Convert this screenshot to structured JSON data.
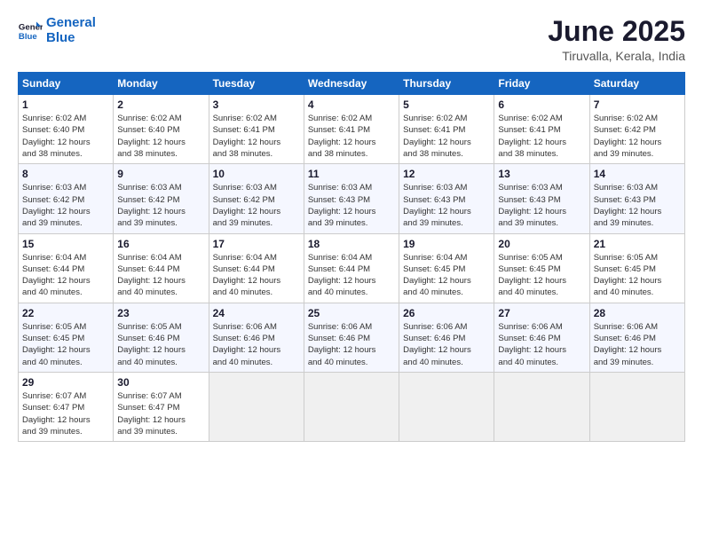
{
  "logo": {
    "line1": "General",
    "line2": "Blue"
  },
  "title": "June 2025",
  "subtitle": "Tiruvalla, Kerala, India",
  "weekdays": [
    "Sunday",
    "Monday",
    "Tuesday",
    "Wednesday",
    "Thursday",
    "Friday",
    "Saturday"
  ],
  "weeks": [
    [
      {
        "day": "1",
        "detail": "Sunrise: 6:02 AM\nSunset: 6:40 PM\nDaylight: 12 hours\nand 38 minutes."
      },
      {
        "day": "2",
        "detail": "Sunrise: 6:02 AM\nSunset: 6:40 PM\nDaylight: 12 hours\nand 38 minutes."
      },
      {
        "day": "3",
        "detail": "Sunrise: 6:02 AM\nSunset: 6:41 PM\nDaylight: 12 hours\nand 38 minutes."
      },
      {
        "day": "4",
        "detail": "Sunrise: 6:02 AM\nSunset: 6:41 PM\nDaylight: 12 hours\nand 38 minutes."
      },
      {
        "day": "5",
        "detail": "Sunrise: 6:02 AM\nSunset: 6:41 PM\nDaylight: 12 hours\nand 38 minutes."
      },
      {
        "day": "6",
        "detail": "Sunrise: 6:02 AM\nSunset: 6:41 PM\nDaylight: 12 hours\nand 38 minutes."
      },
      {
        "day": "7",
        "detail": "Sunrise: 6:02 AM\nSunset: 6:42 PM\nDaylight: 12 hours\nand 39 minutes."
      }
    ],
    [
      {
        "day": "8",
        "detail": "Sunrise: 6:03 AM\nSunset: 6:42 PM\nDaylight: 12 hours\nand 39 minutes."
      },
      {
        "day": "9",
        "detail": "Sunrise: 6:03 AM\nSunset: 6:42 PM\nDaylight: 12 hours\nand 39 minutes."
      },
      {
        "day": "10",
        "detail": "Sunrise: 6:03 AM\nSunset: 6:42 PM\nDaylight: 12 hours\nand 39 minutes."
      },
      {
        "day": "11",
        "detail": "Sunrise: 6:03 AM\nSunset: 6:43 PM\nDaylight: 12 hours\nand 39 minutes."
      },
      {
        "day": "12",
        "detail": "Sunrise: 6:03 AM\nSunset: 6:43 PM\nDaylight: 12 hours\nand 39 minutes."
      },
      {
        "day": "13",
        "detail": "Sunrise: 6:03 AM\nSunset: 6:43 PM\nDaylight: 12 hours\nand 39 minutes."
      },
      {
        "day": "14",
        "detail": "Sunrise: 6:03 AM\nSunset: 6:43 PM\nDaylight: 12 hours\nand 39 minutes."
      }
    ],
    [
      {
        "day": "15",
        "detail": "Sunrise: 6:04 AM\nSunset: 6:44 PM\nDaylight: 12 hours\nand 40 minutes."
      },
      {
        "day": "16",
        "detail": "Sunrise: 6:04 AM\nSunset: 6:44 PM\nDaylight: 12 hours\nand 40 minutes."
      },
      {
        "day": "17",
        "detail": "Sunrise: 6:04 AM\nSunset: 6:44 PM\nDaylight: 12 hours\nand 40 minutes."
      },
      {
        "day": "18",
        "detail": "Sunrise: 6:04 AM\nSunset: 6:44 PM\nDaylight: 12 hours\nand 40 minutes."
      },
      {
        "day": "19",
        "detail": "Sunrise: 6:04 AM\nSunset: 6:45 PM\nDaylight: 12 hours\nand 40 minutes."
      },
      {
        "day": "20",
        "detail": "Sunrise: 6:05 AM\nSunset: 6:45 PM\nDaylight: 12 hours\nand 40 minutes."
      },
      {
        "day": "21",
        "detail": "Sunrise: 6:05 AM\nSunset: 6:45 PM\nDaylight: 12 hours\nand 40 minutes."
      }
    ],
    [
      {
        "day": "22",
        "detail": "Sunrise: 6:05 AM\nSunset: 6:45 PM\nDaylight: 12 hours\nand 40 minutes."
      },
      {
        "day": "23",
        "detail": "Sunrise: 6:05 AM\nSunset: 6:46 PM\nDaylight: 12 hours\nand 40 minutes."
      },
      {
        "day": "24",
        "detail": "Sunrise: 6:06 AM\nSunset: 6:46 PM\nDaylight: 12 hours\nand 40 minutes."
      },
      {
        "day": "25",
        "detail": "Sunrise: 6:06 AM\nSunset: 6:46 PM\nDaylight: 12 hours\nand 40 minutes."
      },
      {
        "day": "26",
        "detail": "Sunrise: 6:06 AM\nSunset: 6:46 PM\nDaylight: 12 hours\nand 40 minutes."
      },
      {
        "day": "27",
        "detail": "Sunrise: 6:06 AM\nSunset: 6:46 PM\nDaylight: 12 hours\nand 40 minutes."
      },
      {
        "day": "28",
        "detail": "Sunrise: 6:06 AM\nSunset: 6:46 PM\nDaylight: 12 hours\nand 39 minutes."
      }
    ],
    [
      {
        "day": "29",
        "detail": "Sunrise: 6:07 AM\nSunset: 6:47 PM\nDaylight: 12 hours\nand 39 minutes."
      },
      {
        "day": "30",
        "detail": "Sunrise: 6:07 AM\nSunset: 6:47 PM\nDaylight: 12 hours\nand 39 minutes."
      },
      {
        "day": "",
        "detail": ""
      },
      {
        "day": "",
        "detail": ""
      },
      {
        "day": "",
        "detail": ""
      },
      {
        "day": "",
        "detail": ""
      },
      {
        "day": "",
        "detail": ""
      }
    ]
  ]
}
